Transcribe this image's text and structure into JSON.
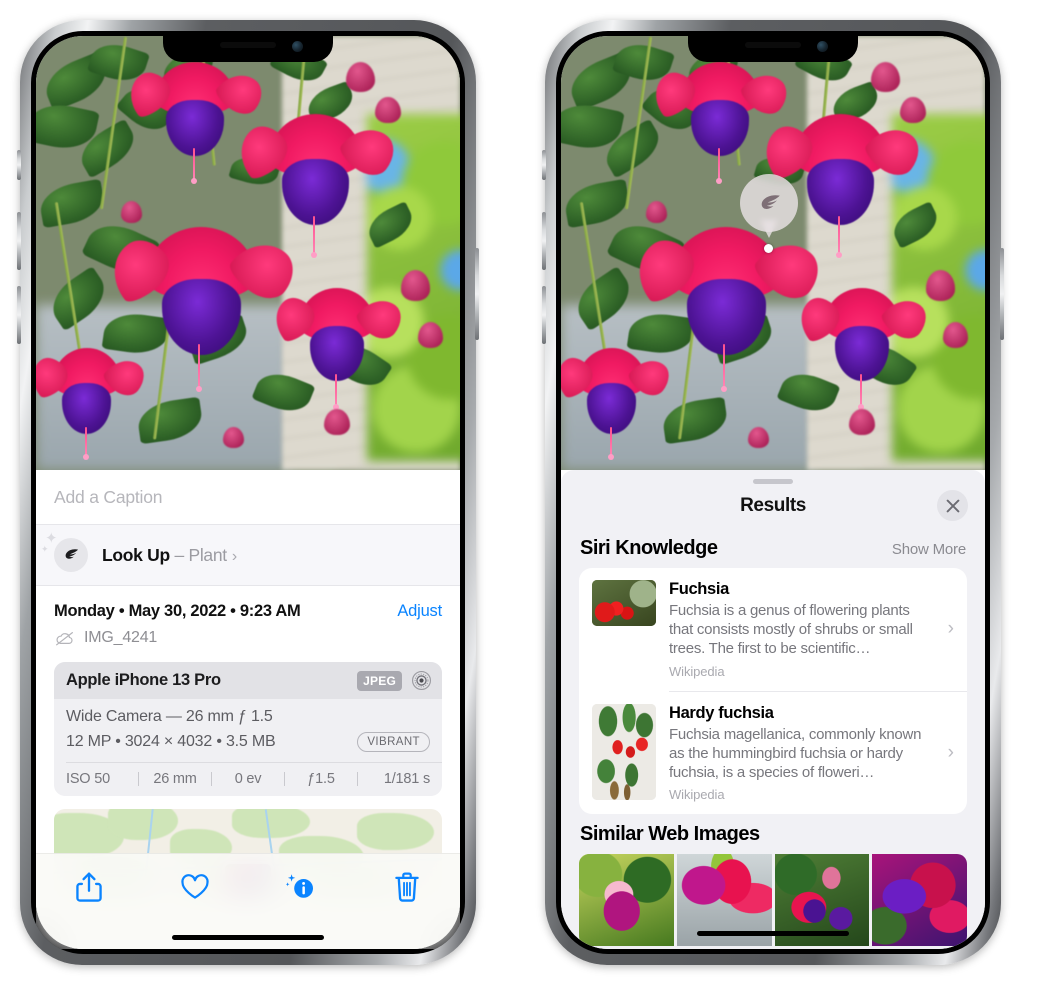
{
  "left_phone": {
    "caption": {
      "placeholder": "Add a Caption",
      "value": ""
    },
    "lookup": {
      "icon": "leaf-icon",
      "label": "Look Up",
      "separator": " – ",
      "subject": "Plant",
      "chevron": "›"
    },
    "meta": {
      "date": "Monday • May 30, 2022 • 9:23 AM",
      "adjust_label": "Adjust",
      "cloud_icon": "cloud-slash-icon",
      "filename": "IMG_4241"
    },
    "exif": {
      "model": "Apple iPhone 13 Pro",
      "format_badge": "JPEG",
      "lens_icon": "lens-icon",
      "lens_line": "Wide Camera — 26 mm ƒ 1.5",
      "size_line": "12 MP • 3024 × 4032 • 3.5 MB",
      "style_badge": "VIBRANT",
      "stats": [
        "ISO 50",
        "26 mm",
        "0 ev",
        "ƒ1.5",
        "1/181 s"
      ]
    },
    "map": {
      "pin_label": "photo-pin"
    },
    "toolbar": [
      {
        "name": "share-icon",
        "label": "Share"
      },
      {
        "name": "favorite-heart-icon",
        "label": "Favorite"
      },
      {
        "name": "info-sparkle-icon",
        "label": "Info"
      },
      {
        "name": "trash-icon",
        "label": "Delete"
      }
    ]
  },
  "right_phone": {
    "photo_badge": {
      "icon": "leaf-icon",
      "label": "Visual Look Up"
    },
    "sheet": {
      "grabber": "sheet-grabber",
      "title": "Results",
      "close_icon": "close-icon"
    },
    "siri_knowledge": {
      "title": "Siri Knowledge",
      "action": "Show More",
      "items": [
        {
          "title": "Fuchsia",
          "description": "Fuchsia is a genus of flowering plants that consists mostly of shrubs or small trees. The first to be scientific…",
          "source": "Wikipedia",
          "chevron": "›"
        },
        {
          "title": "Hardy fuchsia",
          "description": "Fuchsia magellanica, commonly known as the hummingbird fuchsia or hardy fuchsia, is a species of floweri…",
          "source": "Wikipedia",
          "chevron": "›"
        }
      ]
    },
    "similar_web_images": {
      "title": "Similar Web Images",
      "count": 4
    }
  },
  "colors": {
    "accent_blue": "#0a84ff",
    "sheet_bg": "#f1f1f5",
    "card_bg": "#ffffff",
    "secondary_text": "#8e8e93",
    "flower_pink": "#f01a62",
    "flower_purple": "#4d1394"
  }
}
